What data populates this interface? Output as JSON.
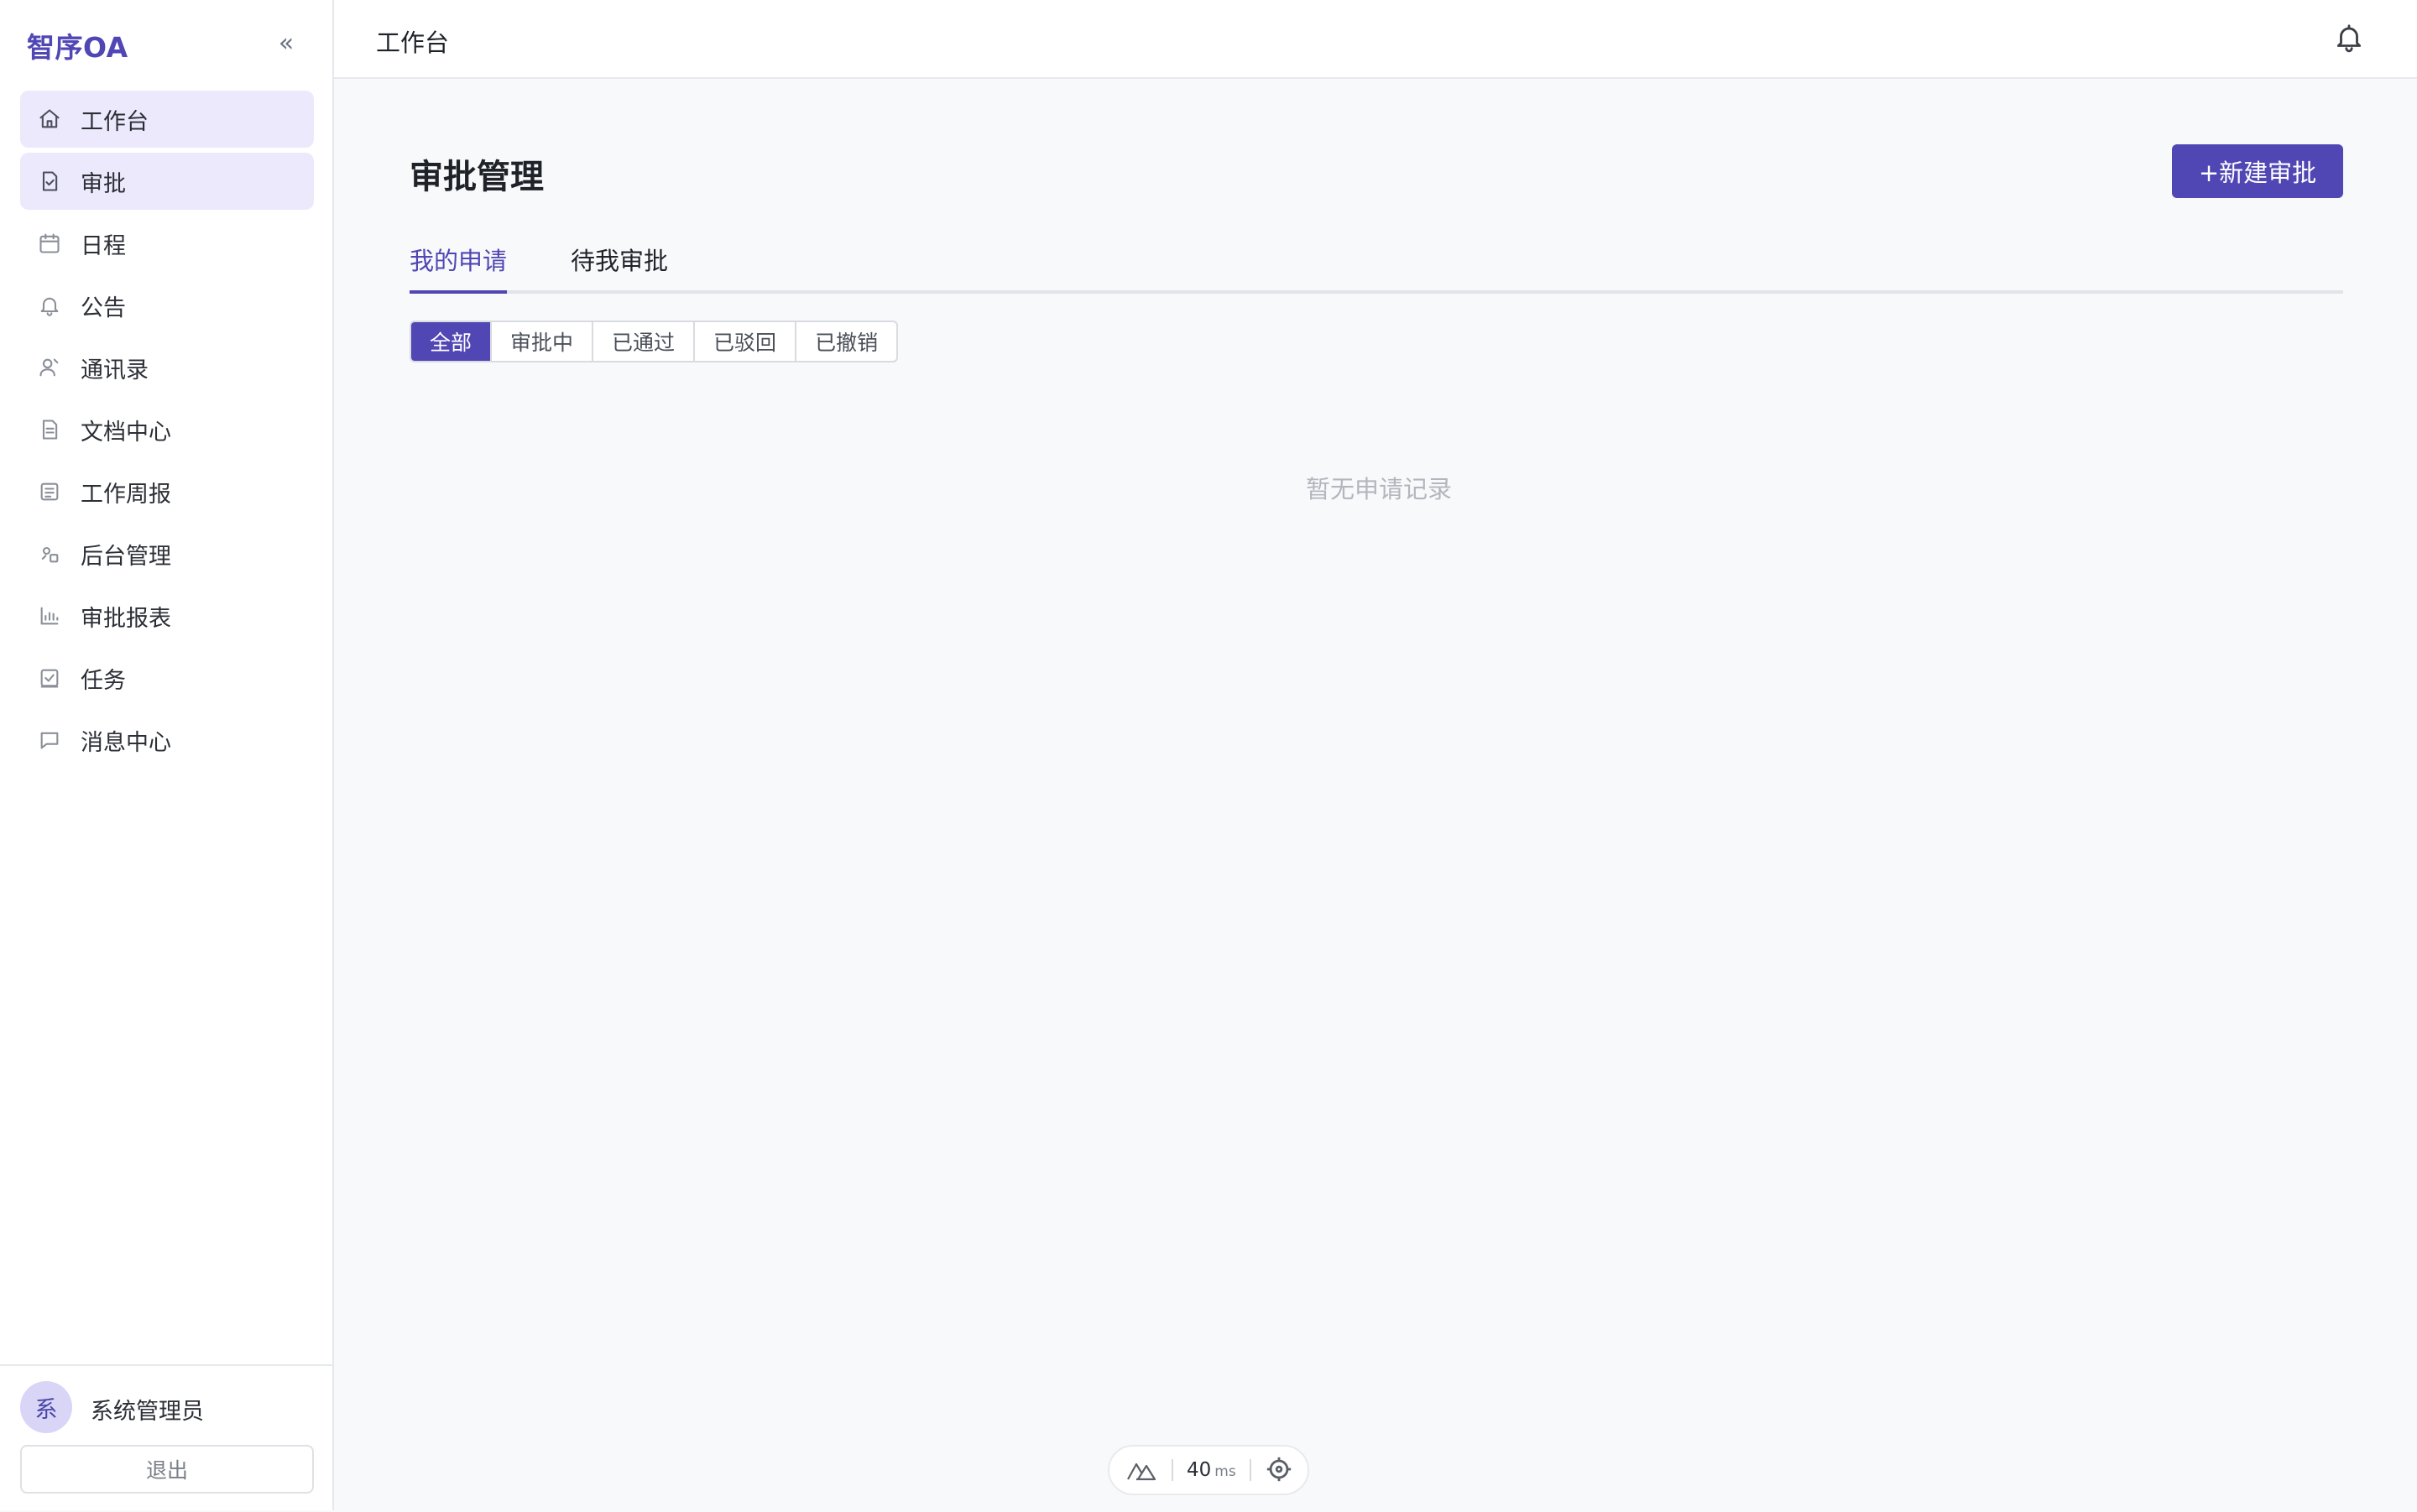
{
  "sidebar": {
    "brand": "智序OA",
    "collapse_label": "«",
    "items": [
      {
        "label": "工作台",
        "icon": "home-icon",
        "active": true
      },
      {
        "label": "审批",
        "icon": "approval-doc-icon",
        "active": true
      },
      {
        "label": "日程",
        "icon": "calendar-icon",
        "active": false
      },
      {
        "label": "公告",
        "icon": "bell-icon",
        "active": false
      },
      {
        "label": "通讯录",
        "icon": "contacts-icon",
        "active": false
      },
      {
        "label": "文档中心",
        "icon": "document-icon",
        "active": false
      },
      {
        "label": "工作周报",
        "icon": "report-icon",
        "active": false
      },
      {
        "label": "后台管理",
        "icon": "admin-icon",
        "active": false
      },
      {
        "label": "审批报表",
        "icon": "bar-chart-icon",
        "active": false
      },
      {
        "label": "任务",
        "icon": "task-check-icon",
        "active": false
      },
      {
        "label": "消息中心",
        "icon": "message-icon",
        "active": false
      }
    ],
    "user": {
      "avatar_text": "系",
      "name": "系统管理员"
    },
    "logout_label": "退出"
  },
  "topbar": {
    "title": "工作台",
    "bell_icon": "bell-icon"
  },
  "main": {
    "page_title": "审批管理",
    "new_button_label": "+新建审批",
    "tabs": [
      {
        "label": "我的申请",
        "active": true
      },
      {
        "label": "待我审批",
        "active": false
      }
    ],
    "filters": [
      {
        "label": "全部",
        "active": true
      },
      {
        "label": "审批中",
        "active": false
      },
      {
        "label": "已通过",
        "active": false
      },
      {
        "label": "已驳回",
        "active": false
      },
      {
        "label": "已撤销",
        "active": false
      }
    ],
    "empty_text": "暂无申请记录"
  },
  "dev_indicator": {
    "value": "40",
    "unit": "ms"
  },
  "colors": {
    "accent": "#5046b4",
    "active_nav_bg": "#ebe9fb"
  }
}
